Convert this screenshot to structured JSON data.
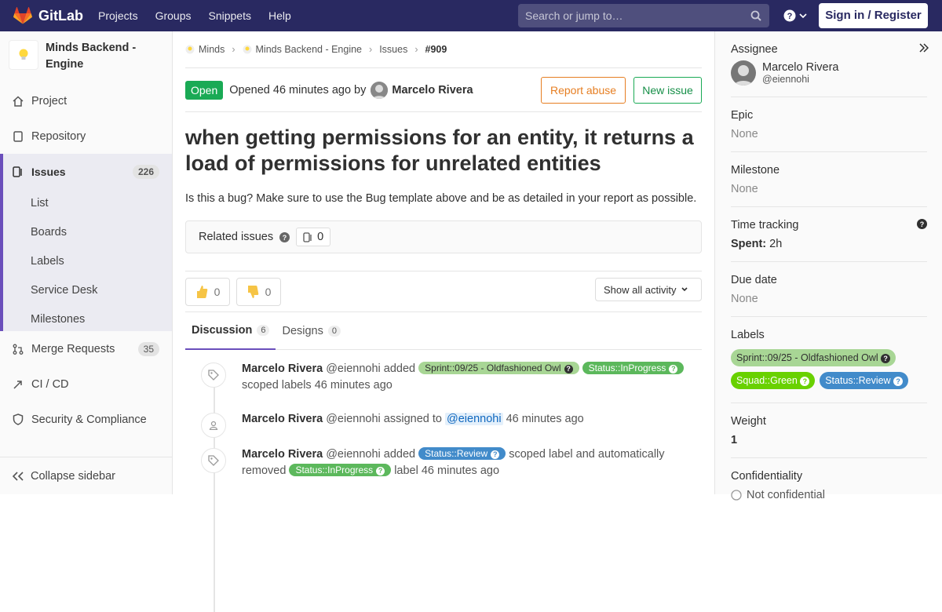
{
  "topbar": {
    "brand": "GitLab",
    "nav": [
      "Projects",
      "Groups",
      "Snippets",
      "Help"
    ],
    "search_placeholder": "Search or jump to…",
    "signin": "Sign in / Register"
  },
  "sidebar": {
    "project_name": "Minds Backend - Engine",
    "items": [
      {
        "label": "Project"
      },
      {
        "label": "Repository"
      }
    ],
    "issues": {
      "label": "Issues",
      "count": "226",
      "sub": [
        "List",
        "Boards",
        "Labels",
        "Service Desk",
        "Milestones"
      ]
    },
    "merge_requests": {
      "label": "Merge Requests",
      "count": "35"
    },
    "cicd": "CI / CD",
    "security": "Security & Compliance",
    "collapse": "Collapse sidebar"
  },
  "breadcrumb": [
    "Minds",
    "Minds Backend - Engine",
    "Issues",
    "#909"
  ],
  "issue": {
    "status": "Open",
    "opened": "Opened 46 minutes ago by",
    "author": "Marcelo Rivera",
    "report_abuse": "Report abuse",
    "new_issue": "New issue",
    "title": "when getting permissions for an entity, it returns a load of permissions for unrelated entities",
    "description": "Is this a bug? Make sure to use the Bug template above and be as detailed in your report as possible.",
    "related_label": "Related issues",
    "related_count": "0"
  },
  "awards": {
    "thumbs_up": "0",
    "thumbs_down": "0",
    "show_all": "Show all activity"
  },
  "tabs": [
    {
      "label": "Discussion",
      "count": "6"
    },
    {
      "label": "Designs",
      "count": "0"
    }
  ],
  "notes": [
    {
      "author": "Marcelo Rivera",
      "handle": "@eiennohi",
      "action": "added",
      "labels": [
        "Sprint::09/25 - Oldfashioned Owl",
        "Status::InProgress"
      ],
      "tail": "scoped labels 46 minutes ago"
    },
    {
      "author": "Marcelo Rivera",
      "handle": "@eiennohi",
      "action": "assigned to",
      "mention": "@eiennohi",
      "time": "46 minutes ago"
    },
    {
      "author": "Marcelo Rivera",
      "handle": "@eiennohi",
      "action": "added",
      "label": "Status::Review",
      "mid": "scoped label and automatically removed",
      "label2": "Status::InProgress",
      "tail": "label 46 minutes ago"
    }
  ],
  "right": {
    "assignee_h": "Assignee",
    "assignee_name": "Marcelo Rivera",
    "assignee_handle": "@eiennohi",
    "epic_h": "Epic",
    "epic_v": "None",
    "milestone_h": "Milestone",
    "milestone_v": "None",
    "time_h": "Time tracking",
    "spent_k": "Spent:",
    "spent_v": "2h",
    "due_h": "Due date",
    "due_v": "None",
    "labels_h": "Labels",
    "labels": [
      {
        "text": "Sprint::09/25 - Oldfashioned Owl",
        "color": "#a8d695"
      },
      {
        "text": "Squad::Green",
        "color": "#69d100"
      },
      {
        "text": "Status::Review",
        "color": "#428bca"
      }
    ],
    "weight_h": "Weight",
    "weight_v": "1",
    "conf_h": "Confidentiality",
    "conf_v": "Not confidential"
  },
  "colors": {
    "topbar": "#292961",
    "open": "#1aaa55",
    "accent": "#6b4fbb",
    "label_inprogress": "#5cb85c",
    "label_review": "#428bca"
  }
}
